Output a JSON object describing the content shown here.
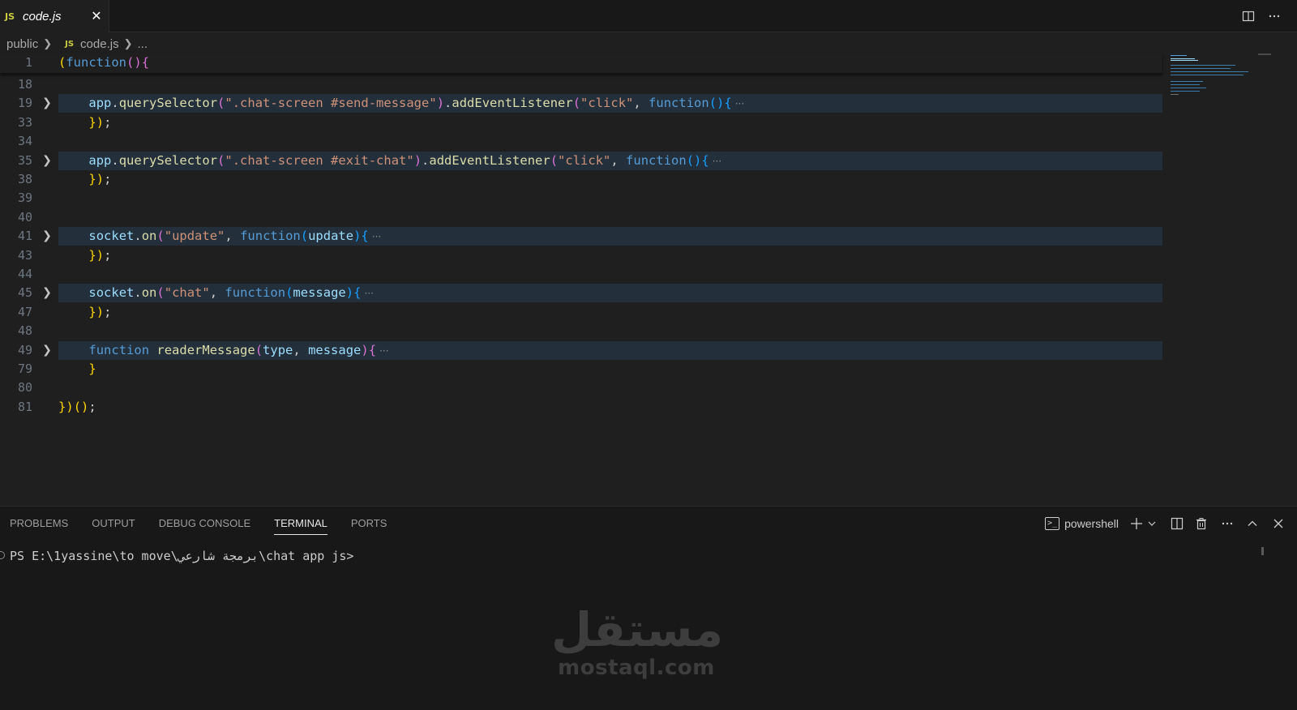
{
  "tab": {
    "lang_badge": "JS",
    "filename": "code.js",
    "close_glyph": "✕"
  },
  "tab_actions": {
    "split_icon": "split-editor-icon",
    "more_icon": "more-actions-icon"
  },
  "breadcrumb": {
    "folder": "public",
    "lang_badge": "JS",
    "file": "code.js",
    "more": "..."
  },
  "editor": {
    "sticky_line": {
      "number": "1",
      "text": "(function(){"
    },
    "lines": [
      {
        "number": "18",
        "folded": false,
        "text": ""
      },
      {
        "number": "19",
        "folded": true,
        "text": "    app.querySelector(\".chat-screen #send-message\").addEventListener(\"click\", function(){"
      },
      {
        "number": "33",
        "folded": false,
        "text": "    });"
      },
      {
        "number": "34",
        "folded": false,
        "text": ""
      },
      {
        "number": "35",
        "folded": true,
        "text": "    app.querySelector(\".chat-screen #exit-chat\").addEventListener(\"click\", function(){"
      },
      {
        "number": "38",
        "folded": false,
        "text": "    });"
      },
      {
        "number": "39",
        "folded": false,
        "text": ""
      },
      {
        "number": "40",
        "folded": false,
        "text": ""
      },
      {
        "number": "41",
        "folded": true,
        "text": "    socket.on(\"update\", function(update){"
      },
      {
        "number": "43",
        "folded": false,
        "text": "    });"
      },
      {
        "number": "44",
        "folded": false,
        "text": ""
      },
      {
        "number": "45",
        "folded": true,
        "text": "    socket.on(\"chat\", function(message){"
      },
      {
        "number": "47",
        "folded": false,
        "text": "    });"
      },
      {
        "number": "48",
        "folded": false,
        "text": ""
      },
      {
        "number": "49",
        "folded": true,
        "text": "    function readerMessage(type, message){"
      },
      {
        "number": "79",
        "folded": false,
        "text": "    }"
      },
      {
        "number": "80",
        "folded": false,
        "text": ""
      },
      {
        "number": "81",
        "folded": false,
        "text": "})();"
      }
    ],
    "fold_glyph": "❯",
    "ellipsis": "···"
  },
  "panel": {
    "tabs": [
      "PROBLEMS",
      "OUTPUT",
      "DEBUG CONSOLE",
      "TERMINAL",
      "PORTS"
    ],
    "active_tab": "TERMINAL",
    "terminal_name": "powershell",
    "terminal_prompt": "PS E:\\1yassine\\to move\\برمجة شارعي\\chat app js>"
  },
  "watermark": {
    "arabic": "مستقل",
    "latin": "mostaql.com"
  },
  "colors": {
    "keyword": "#569cd6",
    "function": "#dcdcaa",
    "string": "#ce9178",
    "variable": "#9cdcfe",
    "bracket1": "#ffd700",
    "bracket2": "#da70d6",
    "bracket3": "#179fff",
    "folded_bg": "#23303b"
  }
}
